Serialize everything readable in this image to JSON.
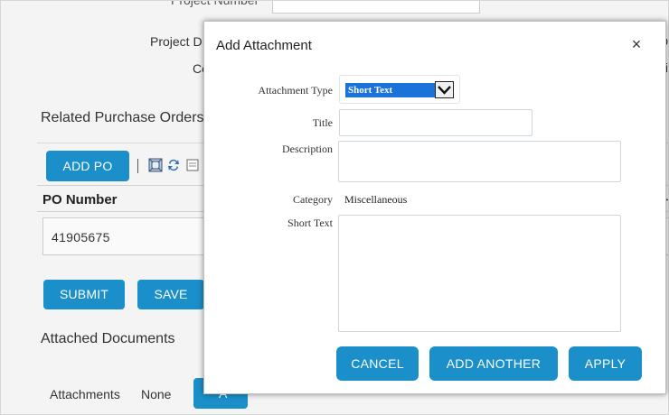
{
  "background": {
    "top_cut_label": "Project Number",
    "project_desc_label": "Project D",
    "co_label": "Co",
    "right_cut_1": "mb",
    "right_cut_2": "pti",
    "related_po_title": "Related Purchase Orders",
    "add_po_label": "ADD PO",
    "po_header_label": "PO Number",
    "po_header_right_cut": "er",
    "po_rows": [
      "41905675"
    ],
    "submit_label": "SUBMIT",
    "save_label": "SAVE",
    "attached_docs_title": "Attached Documents",
    "attachments_label": "Attachments",
    "attachments_value": "None",
    "attach_button_label": "A"
  },
  "modal": {
    "title": "Add Attachment",
    "close_glyph": "×",
    "fields": {
      "attachment_type_label": "Attachment Type",
      "attachment_type_value": "Short Text",
      "title_label": "Title",
      "title_value": "",
      "description_label": "Description",
      "description_value": "",
      "category_label": "Category",
      "category_value": "Miscellaneous",
      "short_text_label": "Short Text",
      "short_text_value": ""
    },
    "buttons": {
      "cancel": "CANCEL",
      "add_another": "ADD ANOTHER",
      "apply": "APPLY"
    }
  },
  "colors": {
    "accent": "#1a8fc9",
    "select_highlight": "#1a73d9"
  }
}
